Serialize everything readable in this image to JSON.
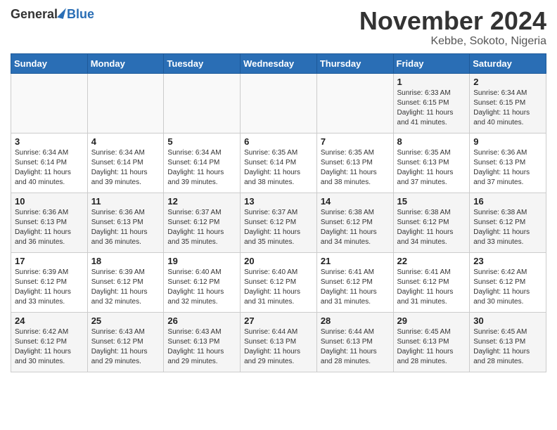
{
  "header": {
    "logo": {
      "general": "General",
      "blue": "Blue"
    },
    "title": "November 2024",
    "location": "Kebbe, Sokoto, Nigeria"
  },
  "columns": [
    "Sunday",
    "Monday",
    "Tuesday",
    "Wednesday",
    "Thursday",
    "Friday",
    "Saturday"
  ],
  "weeks": [
    [
      {
        "day": "",
        "info": ""
      },
      {
        "day": "",
        "info": ""
      },
      {
        "day": "",
        "info": ""
      },
      {
        "day": "",
        "info": ""
      },
      {
        "day": "",
        "info": ""
      },
      {
        "day": "1",
        "info": "Sunrise: 6:33 AM\nSunset: 6:15 PM\nDaylight: 11 hours and 41 minutes."
      },
      {
        "day": "2",
        "info": "Sunrise: 6:34 AM\nSunset: 6:15 PM\nDaylight: 11 hours and 40 minutes."
      }
    ],
    [
      {
        "day": "3",
        "info": "Sunrise: 6:34 AM\nSunset: 6:14 PM\nDaylight: 11 hours and 40 minutes."
      },
      {
        "day": "4",
        "info": "Sunrise: 6:34 AM\nSunset: 6:14 PM\nDaylight: 11 hours and 39 minutes."
      },
      {
        "day": "5",
        "info": "Sunrise: 6:34 AM\nSunset: 6:14 PM\nDaylight: 11 hours and 39 minutes."
      },
      {
        "day": "6",
        "info": "Sunrise: 6:35 AM\nSunset: 6:14 PM\nDaylight: 11 hours and 38 minutes."
      },
      {
        "day": "7",
        "info": "Sunrise: 6:35 AM\nSunset: 6:13 PM\nDaylight: 11 hours and 38 minutes."
      },
      {
        "day": "8",
        "info": "Sunrise: 6:35 AM\nSunset: 6:13 PM\nDaylight: 11 hours and 37 minutes."
      },
      {
        "day": "9",
        "info": "Sunrise: 6:36 AM\nSunset: 6:13 PM\nDaylight: 11 hours and 37 minutes."
      }
    ],
    [
      {
        "day": "10",
        "info": "Sunrise: 6:36 AM\nSunset: 6:13 PM\nDaylight: 11 hours and 36 minutes."
      },
      {
        "day": "11",
        "info": "Sunrise: 6:36 AM\nSunset: 6:13 PM\nDaylight: 11 hours and 36 minutes."
      },
      {
        "day": "12",
        "info": "Sunrise: 6:37 AM\nSunset: 6:12 PM\nDaylight: 11 hours and 35 minutes."
      },
      {
        "day": "13",
        "info": "Sunrise: 6:37 AM\nSunset: 6:12 PM\nDaylight: 11 hours and 35 minutes."
      },
      {
        "day": "14",
        "info": "Sunrise: 6:38 AM\nSunset: 6:12 PM\nDaylight: 11 hours and 34 minutes."
      },
      {
        "day": "15",
        "info": "Sunrise: 6:38 AM\nSunset: 6:12 PM\nDaylight: 11 hours and 34 minutes."
      },
      {
        "day": "16",
        "info": "Sunrise: 6:38 AM\nSunset: 6:12 PM\nDaylight: 11 hours and 33 minutes."
      }
    ],
    [
      {
        "day": "17",
        "info": "Sunrise: 6:39 AM\nSunset: 6:12 PM\nDaylight: 11 hours and 33 minutes."
      },
      {
        "day": "18",
        "info": "Sunrise: 6:39 AM\nSunset: 6:12 PM\nDaylight: 11 hours and 32 minutes."
      },
      {
        "day": "19",
        "info": "Sunrise: 6:40 AM\nSunset: 6:12 PM\nDaylight: 11 hours and 32 minutes."
      },
      {
        "day": "20",
        "info": "Sunrise: 6:40 AM\nSunset: 6:12 PM\nDaylight: 11 hours and 31 minutes."
      },
      {
        "day": "21",
        "info": "Sunrise: 6:41 AM\nSunset: 6:12 PM\nDaylight: 11 hours and 31 minutes."
      },
      {
        "day": "22",
        "info": "Sunrise: 6:41 AM\nSunset: 6:12 PM\nDaylight: 11 hours and 31 minutes."
      },
      {
        "day": "23",
        "info": "Sunrise: 6:42 AM\nSunset: 6:12 PM\nDaylight: 11 hours and 30 minutes."
      }
    ],
    [
      {
        "day": "24",
        "info": "Sunrise: 6:42 AM\nSunset: 6:12 PM\nDaylight: 11 hours and 30 minutes."
      },
      {
        "day": "25",
        "info": "Sunrise: 6:43 AM\nSunset: 6:12 PM\nDaylight: 11 hours and 29 minutes."
      },
      {
        "day": "26",
        "info": "Sunrise: 6:43 AM\nSunset: 6:13 PM\nDaylight: 11 hours and 29 minutes."
      },
      {
        "day": "27",
        "info": "Sunrise: 6:44 AM\nSunset: 6:13 PM\nDaylight: 11 hours and 29 minutes."
      },
      {
        "day": "28",
        "info": "Sunrise: 6:44 AM\nSunset: 6:13 PM\nDaylight: 11 hours and 28 minutes."
      },
      {
        "day": "29",
        "info": "Sunrise: 6:45 AM\nSunset: 6:13 PM\nDaylight: 11 hours and 28 minutes."
      },
      {
        "day": "30",
        "info": "Sunrise: 6:45 AM\nSunset: 6:13 PM\nDaylight: 11 hours and 28 minutes."
      }
    ]
  ]
}
